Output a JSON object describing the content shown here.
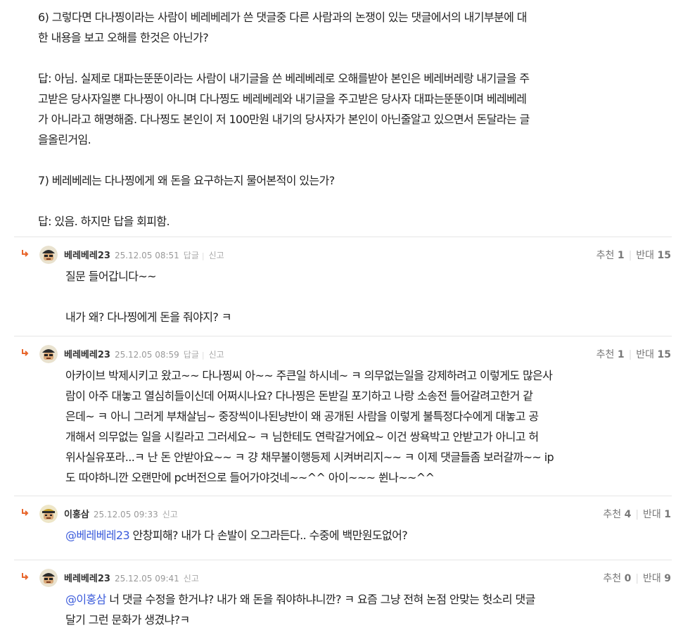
{
  "post": {
    "lines": [
      "6) 그렇다면 다나찡이라는 사람이 베레베레가 쓴 댓글중 다른 사람과의 논쟁이 있는 댓글에서의 내기부분에 대",
      "한 내용을 보고 오해를 한것은 아닌가?",
      "",
      "답: 아님. 실제로 대파는뚠뚠이라는 사람이 내기글을 쓴 베레베레로 오해를받아 본인은 베레버레랑 내기글을 주",
      "고받은 당사자일뿐 다나찡이 아니며 다나찡도 베레베레와 내기글을 주고받은 당사자 대파는뚠뚠이며 베레베레",
      "가 아니라고 해명해줌. 다나찡도 본인이 저 100만원 내기의 당사자가 본인이 아닌줄알고 있으면서 돈달라는 글",
      "을올린거임.",
      "",
      "7) 베레베레는 다나찡에게 왜 돈을 요구하는지 물어본적이 있는가?",
      "",
      "답: 있음. 하지만 답을 회피함."
    ]
  },
  "labels": {
    "reply": "답글",
    "report": "신고",
    "recommend": "추천",
    "oppose": "반대"
  },
  "comments": [
    {
      "nick": "베레베레23",
      "date": "25.12.05 08:51",
      "has_reply": true,
      "up": "1",
      "down": "15",
      "lines": [
        "질문 들어갑니다~~",
        "",
        "내가 왜? 다나찡에게 돈을 줘야지? ㅋ"
      ]
    },
    {
      "nick": "베레베레23",
      "date": "25.12.05 08:59",
      "has_reply": true,
      "up": "1",
      "down": "15",
      "lines": [
        "아카이브 박제시키고 왔고~~ 다나찡씨 아~~ 주큰일 하시네~ ㅋ 의무없는일을 강제하려고 이렇게도 많은사",
        "람이 아주 대놓고 열심히들이신데 어쩌시나요? 다나찡은 돈받길 포기하고 나랑 소송전 들어갈려고한거 같",
        "은데~ ㅋ 아니 그러게 부채살님~ 중장씩이나된냥반이 왜 공개된 사람을 이렇게 불특정다수에게 대놓고 공",
        "개해서 의무없는 일을 시킬라고 그러세요~ ㅋ 님한테도 연락갈거에요~ 이건 쌍욕박고 안받고가 아니고 허",
        "위사실유포라...ㅋ 난 돈 안받아요~~ ㅋ 걍 채무불이행등제 시켜버리지~~ ㅋ 이제 댓글들좀 보러갈까~~ ip",
        "도 따야하니깐 오랜만에 pc버전으로 들어가야것네~~^^ 아이~~~ 쒼나~~^^"
      ]
    },
    {
      "nick": "이홍삼",
      "date": "25.12.05 09:33",
      "has_reply": false,
      "up": "4",
      "down": "1",
      "mention": "@베레베레23",
      "lines": [
        " 안창피해? 내가 다 손발이 오그라든다.. 수중에 백만원도없어?"
      ]
    },
    {
      "nick": "베레베레23",
      "date": "25.12.05 09:41",
      "has_reply": false,
      "up": "0",
      "down": "9",
      "mention": "@이홍삼",
      "lines": [
        " 너 댓글 수정을 한거냐? 내가 왜 돈을 줘야하냐니깐? ㅋ 요즘 그냥 전혀 논점 안맞는 헛소리 댓글",
        "달기 그런 문화가 생겼냐?ㅋ"
      ]
    }
  ]
}
